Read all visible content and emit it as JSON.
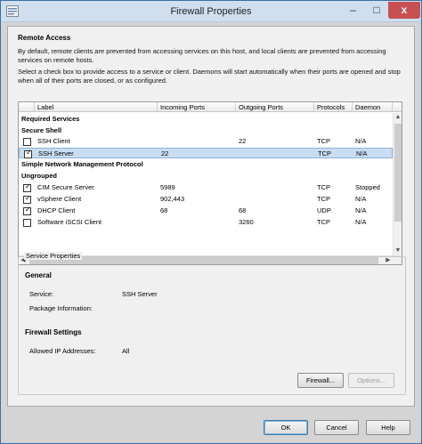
{
  "window": {
    "title": "Firewall Properties",
    "min": "–",
    "max": "□",
    "close": "x"
  },
  "remote_access": {
    "title": "Remote Access",
    "desc1": "By default, remote clients are prevented from accessing services on this host, and local clients are prevented from accessing services on remote hosts.",
    "desc2": "Select a check box to provide access to a service or client. Daemons will start automatically when their ports are opened and stop when all of their ports are closed, or as configured."
  },
  "table": {
    "columns": [
      "Label",
      "Incoming Ports",
      "Outgoing Ports",
      "Protocols",
      "Daemon"
    ],
    "groups": {
      "required": "Required Services",
      "secure_shell": "Secure Shell",
      "snmp": "Simple Network Management Protocol",
      "ungrouped": "Ungrouped"
    },
    "rows": [
      {
        "label": "SSH Client",
        "incoming": "",
        "outgoing": "22",
        "protocol": "TCP",
        "daemon": "N/A",
        "checked": false
      },
      {
        "label": "SSH Server",
        "incoming": "22",
        "outgoing": "",
        "protocol": "TCP",
        "daemon": "N/A",
        "checked": true
      },
      {
        "label": "CIM Secure Server",
        "incoming": "5989",
        "outgoing": "",
        "protocol": "TCP",
        "daemon": "Stopped",
        "checked": true
      },
      {
        "label": "vSphere Client",
        "incoming": "902,443",
        "outgoing": "",
        "protocol": "TCP",
        "daemon": "N/A",
        "checked": true
      },
      {
        "label": "DHCP Client",
        "incoming": "68",
        "outgoing": "68",
        "protocol": "UDP",
        "daemon": "N/A",
        "checked": true
      },
      {
        "label": "Software iSCSI Client",
        "incoming": "",
        "outgoing": "3260",
        "protocol": "TCP",
        "daemon": "N/A",
        "checked": false
      }
    ],
    "check_glyph": "✓"
  },
  "service_properties": {
    "title": "Service Properties",
    "general": "General",
    "service_label": "Service:",
    "service_value": "SSH Server",
    "package_label": "Package Information:",
    "package_value": "",
    "firewall_settings": "Firewall Settings",
    "allowed_ip_label": "Allowed IP Addresses:",
    "allowed_ip_value": "All",
    "firewall_button": "Firewall...",
    "options_button": "Options..."
  },
  "footer": {
    "ok": "OK",
    "cancel": "Cancel",
    "help": "Help"
  }
}
